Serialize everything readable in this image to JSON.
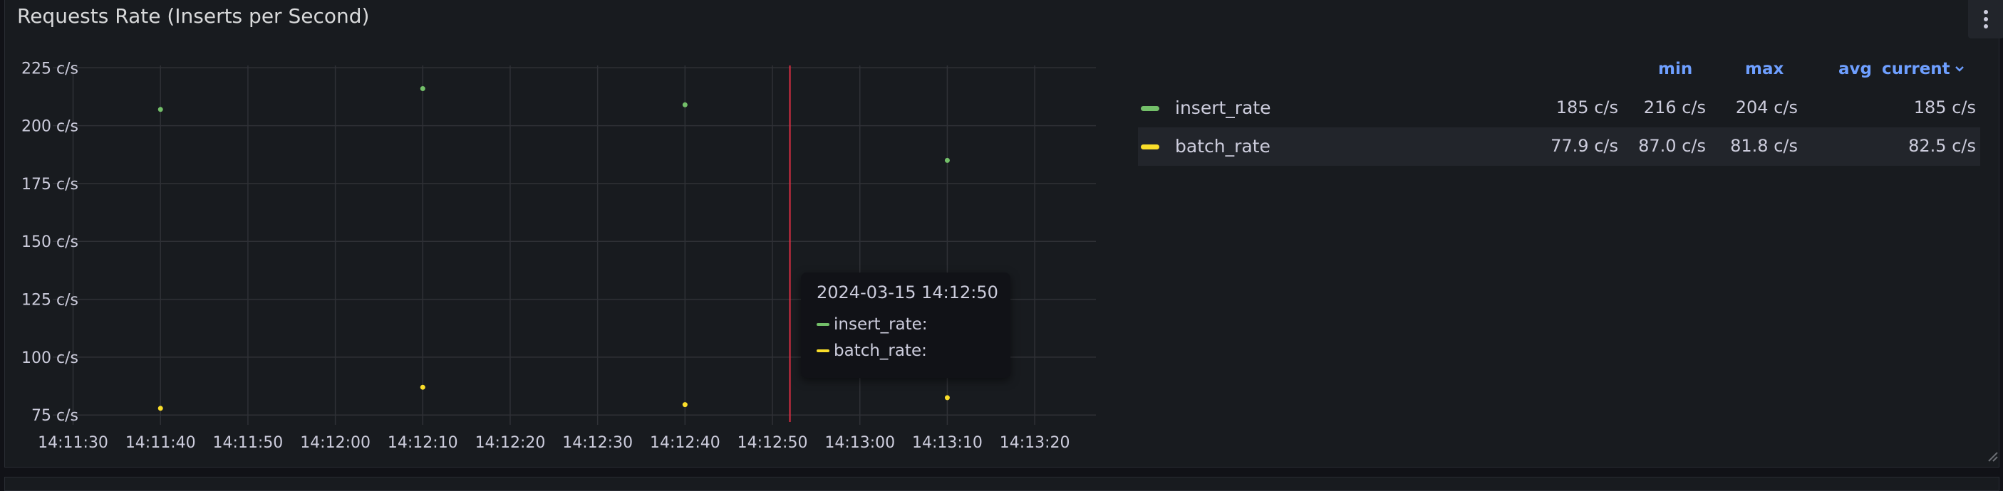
{
  "panel": {
    "title": "Requests Rate (Inserts per Second)",
    "menu_icon": "kebab-menu-icon"
  },
  "colors": {
    "insert_rate": "#73bf69",
    "batch_rate": "#fade2a",
    "cursor": "#e02f44",
    "grid": "#2f3136",
    "legend_header": "#6e9fff"
  },
  "chart_data": {
    "type": "scatter",
    "y_ticks": [
      "225 c/s",
      "200 c/s",
      "175 c/s",
      "150 c/s",
      "125 c/s",
      "100 c/s",
      "75 c/s"
    ],
    "y_tick_values": [
      225,
      200,
      175,
      150,
      125,
      100,
      75
    ],
    "x_ticks": [
      "14:11:30",
      "14:11:40",
      "14:11:50",
      "14:12:00",
      "14:12:10",
      "14:12:20",
      "14:12:30",
      "14:12:40",
      "14:12:50",
      "14:13:00",
      "14:13:10",
      "14:13:20"
    ],
    "xlim": [
      "14:11:28",
      "14:13:27"
    ],
    "ylim": [
      72,
      226
    ],
    "unit": "c/s",
    "grid": true,
    "legend_placement": "right",
    "cursor_x": "14:12:52",
    "series": [
      {
        "name": "insert_rate",
        "x": [
          "14:11:40",
          "14:12:10",
          "14:12:40",
          "14:13:10"
        ],
        "values": [
          207,
          216,
          209,
          185
        ]
      },
      {
        "name": "batch_rate",
        "x": [
          "14:11:40",
          "14:12:10",
          "14:12:40",
          "14:13:10"
        ],
        "values": [
          77.9,
          87.0,
          79.5,
          82.5
        ]
      }
    ]
  },
  "tooltip": {
    "time": "2024-03-15 14:12:50",
    "rows": [
      {
        "label": "insert_rate:"
      },
      {
        "label": "batch_rate:"
      }
    ]
  },
  "legend": {
    "headers": {
      "min": "min",
      "max": "max",
      "avg": "avg",
      "current": "current"
    },
    "sort_icon": "chevron-down-icon",
    "rows": [
      {
        "name": "insert_rate",
        "min": "185 c/s",
        "max": "216 c/s",
        "avg": "204 c/s",
        "current": "185 c/s"
      },
      {
        "name": "batch_rate",
        "min": "77.9 c/s",
        "max": "87.0 c/s",
        "avg": "81.8 c/s",
        "current": "82.5 c/s"
      }
    ]
  }
}
